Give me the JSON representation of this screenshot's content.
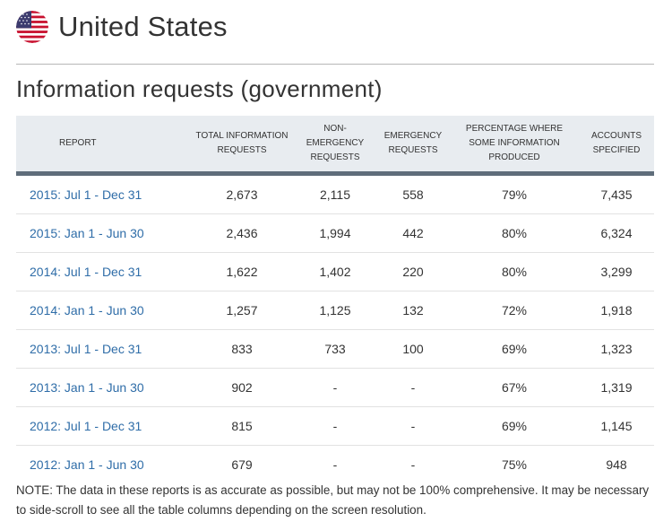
{
  "header": {
    "country": "United States",
    "flag_icon": "us-flag-icon",
    "flag_colors": {
      "red": "#c8102e",
      "white": "#ffffff",
      "blue": "#3c3b6e"
    }
  },
  "section": {
    "title": "Information requests (government)"
  },
  "table": {
    "columns": [
      "REPORT",
      "TOTAL INFORMATION REQUESTS",
      "NON-EMERGENCY REQUESTS",
      "EMERGENCY REQUESTS",
      "PERCENTAGE WHERE SOME INFORMATION PRODUCED",
      "ACCOUNTS SPECIFIED"
    ],
    "rows": [
      {
        "report": "2015: Jul 1 - Dec 31",
        "total": "2,673",
        "non_emergency": "2,115",
        "emergency": "558",
        "percentage": "79%",
        "accounts": "7,435"
      },
      {
        "report": "2015: Jan 1 - Jun 30",
        "total": "2,436",
        "non_emergency": "1,994",
        "emergency": "442",
        "percentage": "80%",
        "accounts": "6,324"
      },
      {
        "report": "2014: Jul 1 - Dec 31",
        "total": "1,622",
        "non_emergency": "1,402",
        "emergency": "220",
        "percentage": "80%",
        "accounts": "3,299"
      },
      {
        "report": "2014: Jan 1 - Jun 30",
        "total": "1,257",
        "non_emergency": "1,125",
        "emergency": "132",
        "percentage": "72%",
        "accounts": "1,918"
      },
      {
        "report": "2013: Jul 1 - Dec 31",
        "total": "833",
        "non_emergency": "733",
        "emergency": "100",
        "percentage": "69%",
        "accounts": "1,323"
      },
      {
        "report": "2013: Jan 1 - Jun 30",
        "total": "902",
        "non_emergency": "-",
        "emergency": "-",
        "percentage": "67%",
        "accounts": "1,319"
      },
      {
        "report": "2012: Jul 1 - Dec 31",
        "total": "815",
        "non_emergency": "-",
        "emergency": "-",
        "percentage": "69%",
        "accounts": "1,145"
      },
      {
        "report": "2012: Jan 1 - Jun 30",
        "total": "679",
        "non_emergency": "-",
        "emergency": "-",
        "percentage": "75%",
        "accounts": "948"
      }
    ]
  },
  "note": "NOTE: The data in these reports is as accurate as possible, but may not be 100% comprehensive. It may be necessary to side-scroll to see all the table columns depending on the screen resolution.",
  "colors": {
    "link": "#2f6da8",
    "header_bg": "#e8ecf0",
    "header_rule": "#5f6d7a",
    "divider": "#b7b7b7"
  }
}
